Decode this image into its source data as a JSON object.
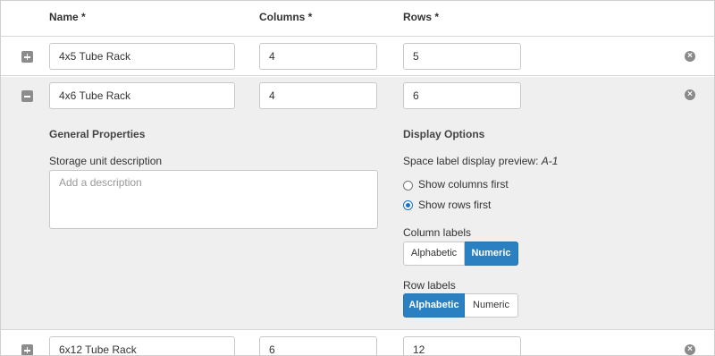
{
  "header": {
    "name": "Name *",
    "columns": "Columns *",
    "rows": "Rows *"
  },
  "units": [
    {
      "name": "4x5 Tube Rack",
      "columns": "4",
      "rows": "5",
      "expanded": false
    },
    {
      "name": "4x6 Tube Rack",
      "columns": "4",
      "rows": "6",
      "expanded": true
    },
    {
      "name": "6x12 Tube Rack",
      "columns": "6",
      "rows": "12",
      "expanded": false
    }
  ],
  "details": {
    "general_title": "General Properties",
    "description_label": "Storage unit description",
    "description_placeholder": "Add a description",
    "display_title": "Display Options",
    "preview_label": "Space label display preview:",
    "preview_value": "A-1",
    "radio_columns_first": "Show columns first",
    "radio_rows_first": "Show rows first",
    "selected_order": "rows",
    "column_labels_title": "Column labels",
    "column_labels_options": [
      "Alphabetic",
      "Numeric"
    ],
    "column_labels_selected": "Numeric",
    "row_labels_title": "Row labels",
    "row_labels_options": [
      "Alphabetic",
      "Numeric"
    ],
    "row_labels_selected": "Alphabetic"
  },
  "icons": {
    "expand": "plus-square-icon",
    "collapse": "minus-square-icon",
    "remove": "times-circle-icon"
  },
  "colors": {
    "accent": "#2a80c0",
    "expanded_bg": "#efefef",
    "icon_gray": "#8c8c8c"
  }
}
